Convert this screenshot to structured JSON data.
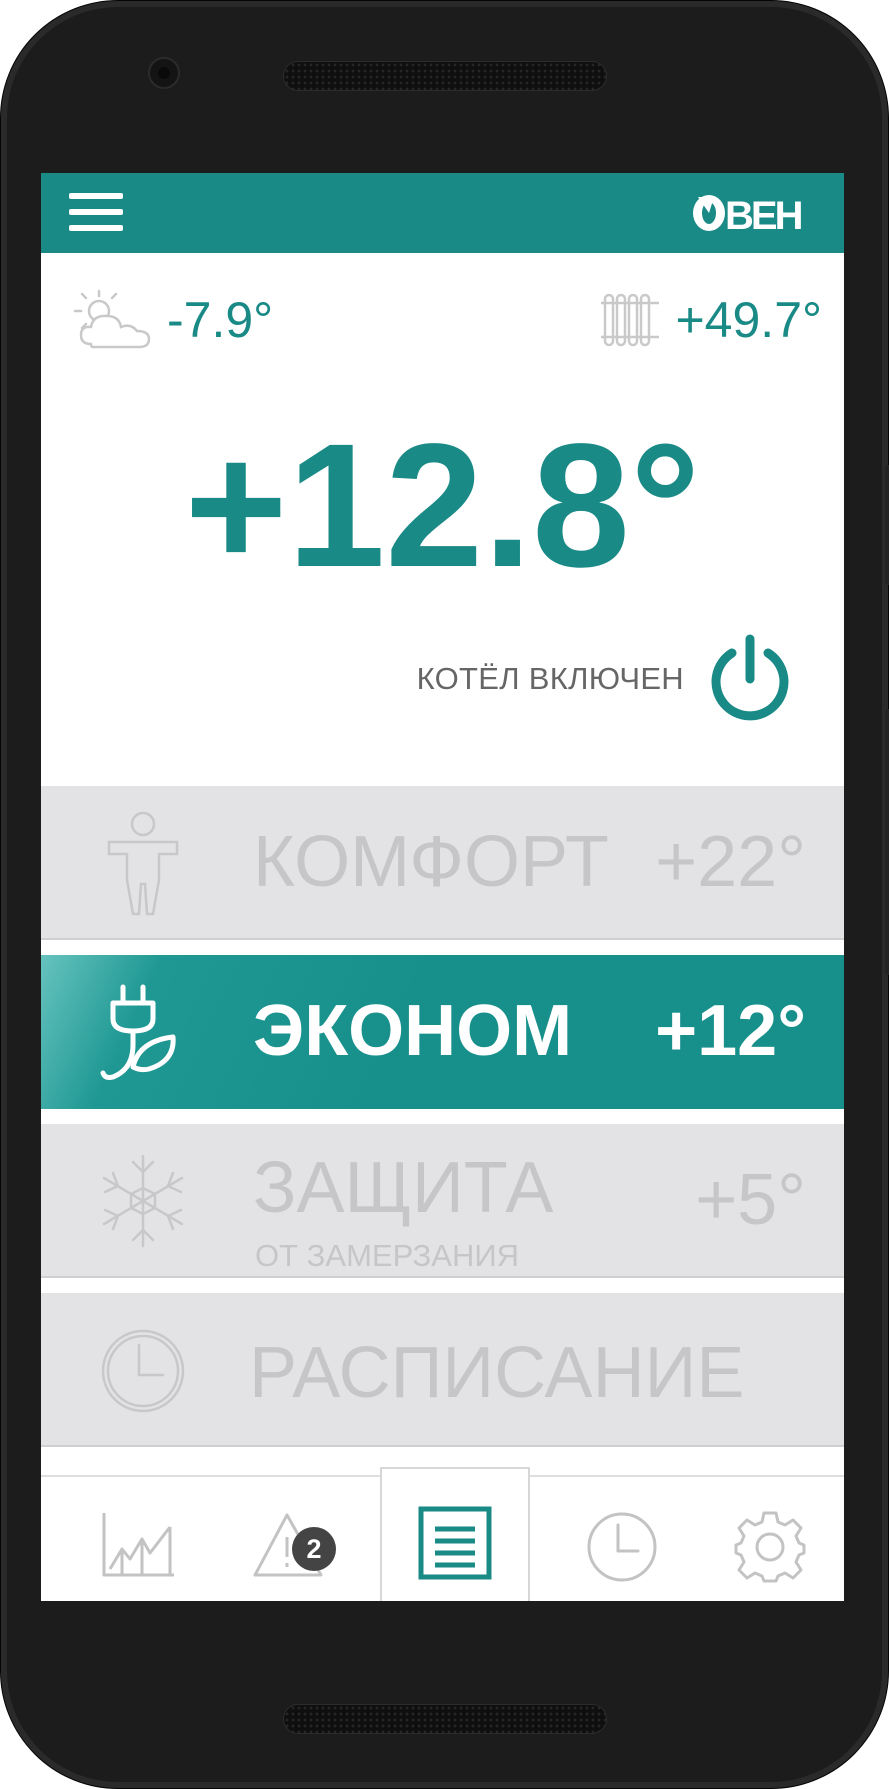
{
  "header": {
    "brand": "ОВЕН"
  },
  "weather": {
    "outdoor_temp": "-7.9°",
    "icon": "partly-cloudy-icon"
  },
  "radiator": {
    "temp": "+49.7°",
    "icon": "radiator-icon"
  },
  "main": {
    "current_temp": "+12.8°"
  },
  "boiler": {
    "status": "КОТЁЛ ВКЛЮЧЕН",
    "icon": "power-icon"
  },
  "modes": [
    {
      "name": "КОМФОРТ",
      "temp": "+22°",
      "icon": "person-icon",
      "active": false
    },
    {
      "name": "ЭКОНОМ",
      "temp": "+12°",
      "icon": "eco-plug-leaf-icon",
      "active": true
    },
    {
      "name": "ЗАЩИТА",
      "subtitle": "ОТ ЗАМЕРЗАНИЯ",
      "temp": "+5°",
      "icon": "snowflake-icon",
      "active": false
    },
    {
      "name": "РАСПИСАНИЕ",
      "icon": "clock-icon",
      "active": false
    }
  ],
  "bottom_nav": {
    "items": [
      {
        "icon": "chart-icon"
      },
      {
        "icon": "alert-icon",
        "badge": "2"
      },
      {
        "icon": "list-icon",
        "active": true
      },
      {
        "icon": "clock-icon"
      },
      {
        "icon": "gear-icon"
      }
    ]
  },
  "colors": {
    "accent": "#1a8a86",
    "inactive_bg": "#e3e3e5",
    "inactive_text": "#c6c6c8"
  }
}
